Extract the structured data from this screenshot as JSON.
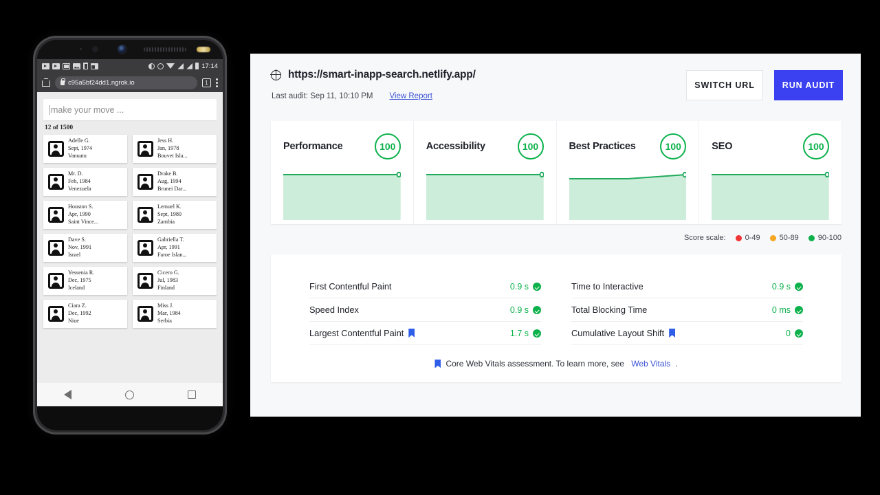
{
  "phone": {
    "status_bar": {
      "time": "17:14",
      "left_icons": [
        "play-icon",
        "play-icon",
        "envelope-icon",
        "image-icon",
        "phone-icon",
        "window-icon"
      ],
      "right_icons": [
        "contrast-icon",
        "alarm-icon",
        "wifi-icon",
        "signal-icon",
        "signal-icon",
        "battery-icon"
      ]
    },
    "browser": {
      "home_icon": "home-icon",
      "lock_icon": "lock-icon",
      "url": "c95a5bf24dd1.ngrok.io",
      "tab_count": "1",
      "menu_icon": "overflow-menu-icon"
    },
    "app": {
      "search_placeholder": "make your move ...",
      "search_value": "",
      "result_count": "12 of 1500",
      "contacts": [
        {
          "name": "Adelle G.",
          "date": "Sept, 1974",
          "country": "Vanuatu"
        },
        {
          "name": "Jess H.",
          "date": "Jan, 1978",
          "country": "Bouvet Isla..."
        },
        {
          "name": "Mr. D.",
          "date": "Feb, 1984",
          "country": "Venezuela"
        },
        {
          "name": "Drake B.",
          "date": "Aug, 1994",
          "country": "Brunei Dar..."
        },
        {
          "name": "Houston S.",
          "date": "Apr, 1990",
          "country": "Saint Vince..."
        },
        {
          "name": "Lemuel K.",
          "date": "Sept, 1980",
          "country": "Zambia"
        },
        {
          "name": "Dave S.",
          "date": "Nov, 1991",
          "country": "Israel"
        },
        {
          "name": "Gabriella T.",
          "date": "Apr, 1991",
          "country": "Faroe Islan..."
        },
        {
          "name": "Yessenia R.",
          "date": "Dec, 1975",
          "country": "Iceland"
        },
        {
          "name": "Cicero G.",
          "date": "Jul, 1983",
          "country": "Finland"
        },
        {
          "name": "Ciara Z.",
          "date": "Dec, 1992",
          "country": "Niue"
        },
        {
          "name": "Miss J.",
          "date": "Mar, 1984",
          "country": "Serbia"
        }
      ]
    },
    "nav_bar": {
      "back": "back-icon",
      "home": "home-circle-icon",
      "recents": "recents-icon"
    }
  },
  "lighthouse": {
    "globe_icon": "globe-icon",
    "url": "https://smart-inapp-search.netlify.app/",
    "last_audit": "Last audit: Sep 11, 10:10 PM",
    "view_report": "View Report",
    "switch_url_label": "SWITCH URL",
    "run_audit_label": "RUN AUDIT",
    "accent_color": "#3b40f0",
    "pass_color": "#0cb14b",
    "score_scale": {
      "label": "Score scale:",
      "items": [
        {
          "range": "0-49",
          "color": "#f03535"
        },
        {
          "range": "50-89",
          "color": "#f5a623"
        },
        {
          "range": "90-100",
          "color": "#0cb14b"
        }
      ]
    },
    "metrics_left": [
      {
        "name": "First Contentful Paint",
        "value": "0.9 s",
        "core_web_vital": false,
        "pass": true
      },
      {
        "name": "Speed Index",
        "value": "0.9 s",
        "core_web_vital": false,
        "pass": true
      },
      {
        "name": "Largest Contentful Paint",
        "value": "1.7 s",
        "core_web_vital": true,
        "pass": true
      }
    ],
    "metrics_right": [
      {
        "name": "Time to Interactive",
        "value": "0.9 s",
        "core_web_vital": false,
        "pass": true
      },
      {
        "name": "Total Blocking Time",
        "value": "0 ms",
        "core_web_vital": false,
        "pass": true
      },
      {
        "name": "Cumulative Layout Shift",
        "value": "0",
        "core_web_vital": true,
        "pass": true
      }
    ],
    "footnote_text": "Core Web Vitals assessment. To learn more, see ",
    "footnote_link": "Web Vitals",
    "footnote_end": "."
  },
  "chart_data": [
    {
      "type": "area",
      "title": "Performance",
      "score": "100",
      "x": [
        0,
        1,
        2,
        3,
        4
      ],
      "values": [
        100,
        100,
        100,
        100,
        100
      ],
      "ylim": [
        0,
        100
      ],
      "line_color": "#0cb14b",
      "fill_color": "#cdeddb",
      "grid": false,
      "legend": "none",
      "end_marker": true
    },
    {
      "type": "area",
      "title": "Accessibility",
      "score": "100",
      "x": [
        0,
        1,
        2,
        3,
        4
      ],
      "values": [
        100,
        100,
        100,
        100,
        100
      ],
      "ylim": [
        0,
        100
      ],
      "line_color": "#0cb14b",
      "fill_color": "#cdeddb",
      "grid": false,
      "legend": "none",
      "end_marker": true
    },
    {
      "type": "area",
      "title": "Best Practices",
      "score": "100",
      "x": [
        0,
        1,
        2,
        3,
        4
      ],
      "values": [
        96,
        96,
        96,
        98,
        100
      ],
      "ylim": [
        0,
        100
      ],
      "line_color": "#0cb14b",
      "fill_color": "#cdeddb",
      "grid": false,
      "legend": "none",
      "end_marker": true
    },
    {
      "type": "area",
      "title": "SEO",
      "score": "100",
      "x": [
        0,
        1,
        2,
        3,
        4
      ],
      "values": [
        100,
        100,
        100,
        100,
        100
      ],
      "ylim": [
        0,
        100
      ],
      "line_color": "#0cb14b",
      "fill_color": "#cdeddb",
      "grid": false,
      "legend": "none",
      "end_marker": true
    }
  ]
}
